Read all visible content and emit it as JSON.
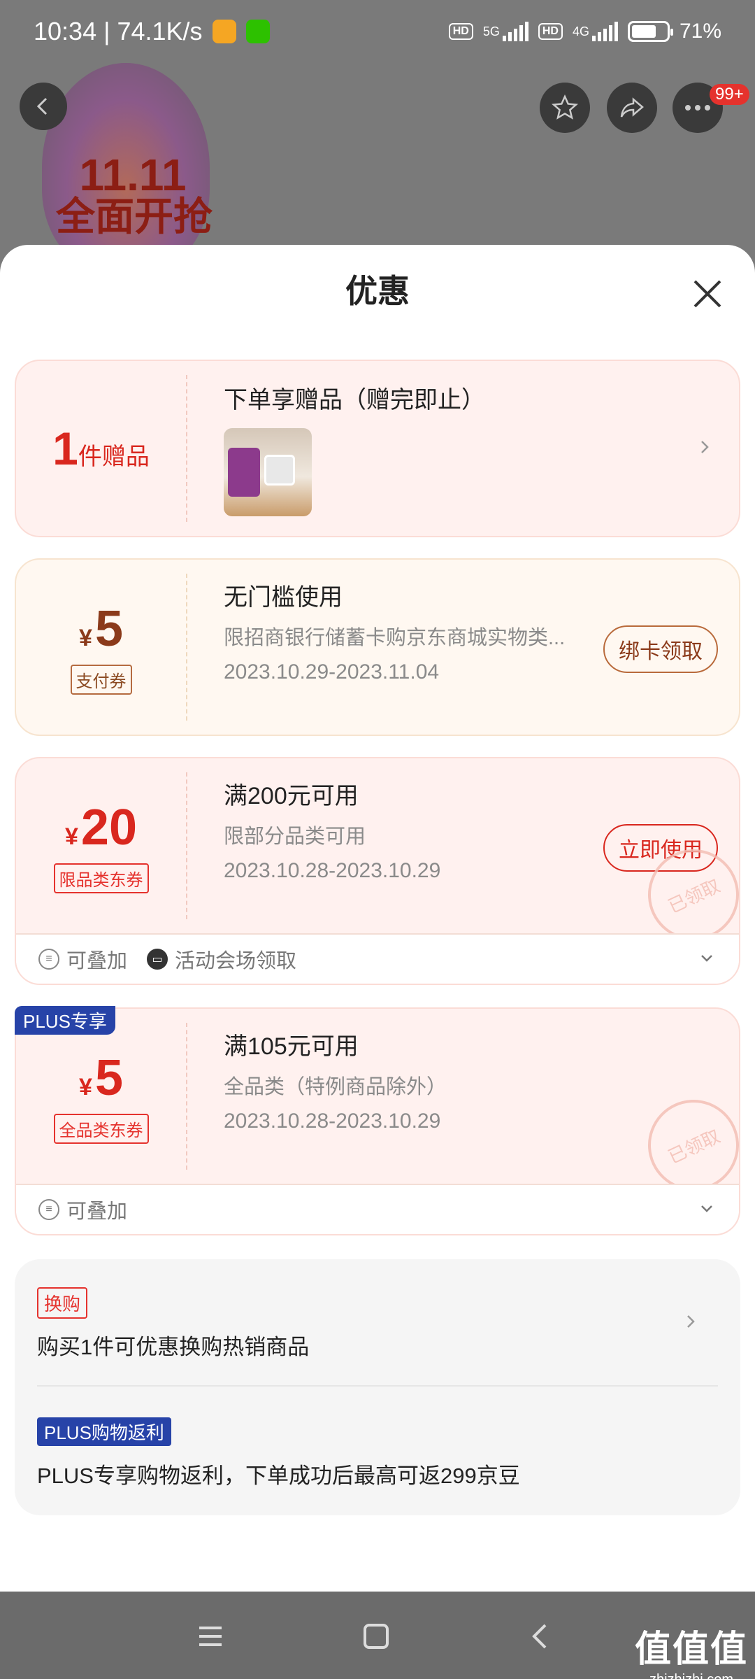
{
  "status_bar": {
    "time_speed": "10:34 | 74.1K/s",
    "hd1": "HD",
    "net1": "5G",
    "hd2": "HD",
    "net2": "4G",
    "battery": "71%",
    "battery_level": 0.71
  },
  "background": {
    "promo_line1": "11.11",
    "promo_line2": "全面开抢",
    "notification_badge": "99+"
  },
  "sheet": {
    "title": "优惠"
  },
  "gift_card": {
    "count": "1",
    "unit": "件赠品",
    "title": "下单享赠品（赠完即止）"
  },
  "coupon_pay": {
    "yen": "¥",
    "amount": "5",
    "tag": "支付券",
    "title": "无门槛使用",
    "subtitle": "限招商银行储蓄卡购京东商城实物类...",
    "date": "2023.10.29-2023.11.04",
    "button": "绑卡领取"
  },
  "coupon_limited": {
    "yen": "¥",
    "amount": "20",
    "tag": "限品类东券",
    "title": "满200元可用",
    "subtitle": "限部分品类可用",
    "date": "2023.10.28-2023.10.29",
    "button": "立即使用",
    "stamp": "已领取",
    "foot_stack": "可叠加",
    "foot_venue": "活动会场领取"
  },
  "coupon_plus": {
    "plus_tag": "PLUS专享",
    "yen": "¥",
    "amount": "5",
    "tag": "全品类东券",
    "title": "满105元可用",
    "subtitle": "全品类（特例商品除外）",
    "date": "2023.10.28-2023.10.29",
    "stamp": "已领取",
    "foot_stack": "可叠加"
  },
  "extras": {
    "swap_tag": "换购",
    "swap_text": "购买1件可优惠换购热销商品",
    "rebate_tag": "PLUS购物返利",
    "rebate_text": "PLUS专享购物返利，下单成功后最高可返299京豆"
  },
  "watermark": {
    "name": "值值值",
    "url": "zhizhizhi.com"
  },
  "colors": {
    "accent_red": "#d9271e",
    "plus_blue": "#2743a8"
  }
}
